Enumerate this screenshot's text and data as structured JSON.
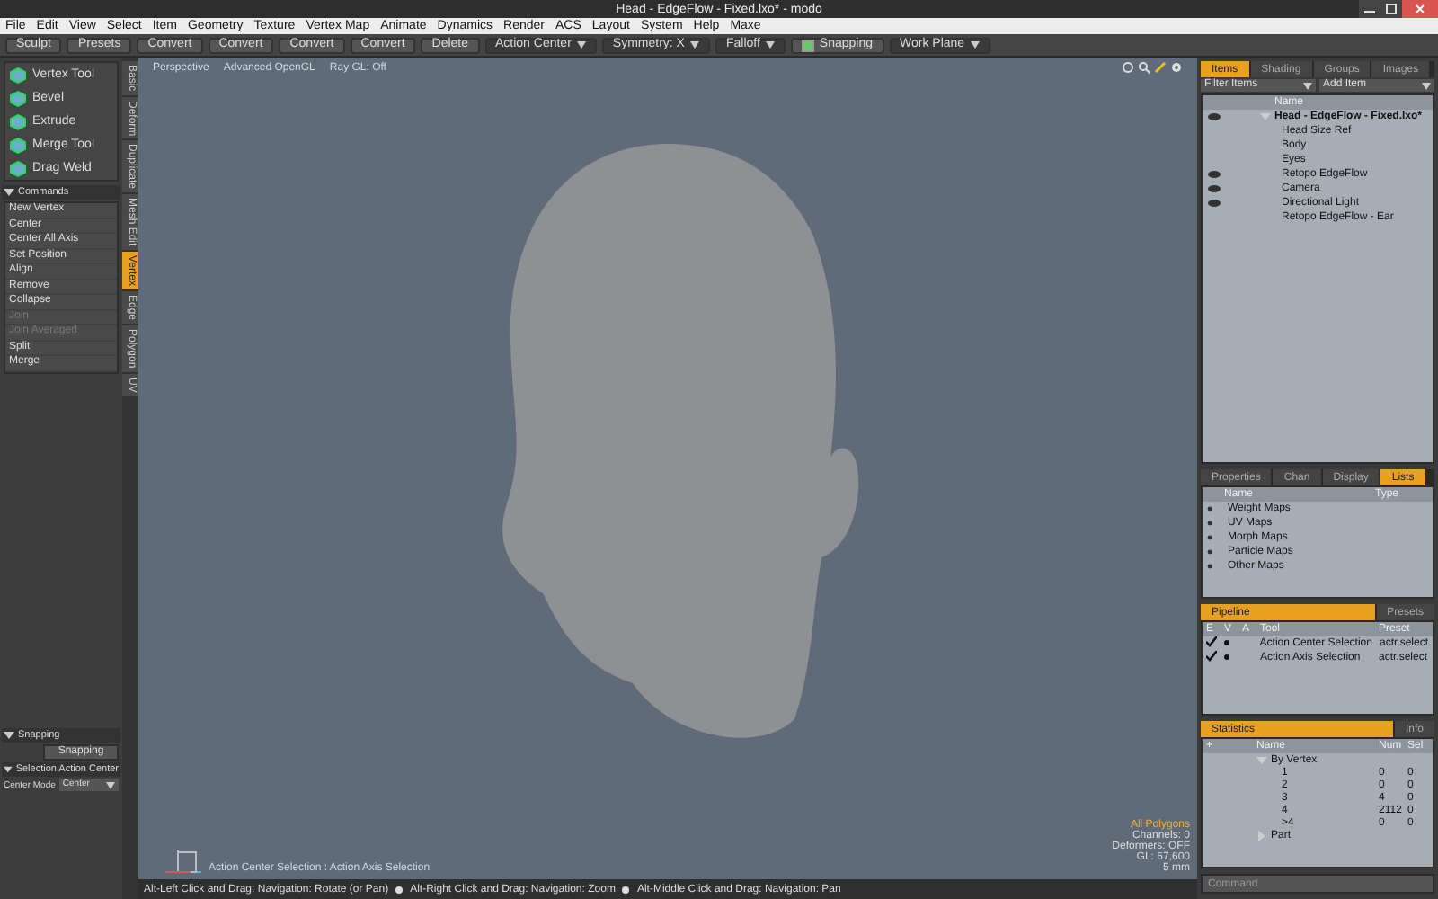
{
  "window": {
    "title": "Head - EdgeFlow - Fixed.lxo* - modo"
  },
  "menu": [
    "File",
    "Edit",
    "View",
    "Select",
    "Item",
    "Geometry",
    "Texture",
    "Vertex Map",
    "Animate",
    "Dynamics",
    "Render",
    "ACS",
    "Layout",
    "System",
    "Help",
    "Maxe"
  ],
  "toolbar": [
    {
      "kind": "button",
      "label": "Sculpt"
    },
    {
      "kind": "button",
      "label": "Presets"
    },
    {
      "kind": "button",
      "label": "Convert"
    },
    {
      "kind": "button",
      "label": "Convert"
    },
    {
      "kind": "button",
      "label": "Convert"
    },
    {
      "kind": "button",
      "label": "Convert"
    },
    {
      "kind": "button",
      "label": "Delete"
    },
    {
      "kind": "dropdown",
      "label": "Action Center"
    },
    {
      "kind": "dropdown",
      "label": "Symmetry: X"
    },
    {
      "kind": "dropdown",
      "label": "Falloff"
    },
    {
      "kind": "toggle",
      "label": "Snapping",
      "checked": true
    },
    {
      "kind": "dropdown",
      "label": "Work Plane"
    }
  ],
  "tools": [
    "Vertex Tool",
    "Bevel",
    "Extrude",
    "Merge Tool",
    "Drag Weld"
  ],
  "commands": {
    "title": "Commands",
    "expanded": true,
    "items": [
      {
        "label": "New Vertex",
        "disabled": false
      },
      {
        "label": "Center",
        "disabled": false
      },
      {
        "label": "Center All Axis",
        "disabled": false
      },
      {
        "label": "Set Position",
        "disabled": false
      },
      {
        "label": "Align",
        "disabled": false
      },
      {
        "label": "Remove",
        "disabled": false
      },
      {
        "label": "Collapse",
        "disabled": false
      },
      {
        "label": "Join",
        "disabled": true
      },
      {
        "label": "Join Averaged",
        "disabled": true
      },
      {
        "label": "Split",
        "disabled": false
      },
      {
        "label": "Merge",
        "disabled": false
      }
    ]
  },
  "snapping": {
    "title": "Snapping",
    "expanded": true,
    "button": "Snapping"
  },
  "action_center": {
    "title": "Selection Action Center",
    "expanded": true,
    "field_label": "Center Mode",
    "value": "Center"
  },
  "side_tabs": [
    {
      "label": "Basic",
      "selected": false
    },
    {
      "label": "Deform",
      "selected": false
    },
    {
      "label": "Duplicate",
      "selected": false
    },
    {
      "label": "Mesh Edit",
      "selected": false
    },
    {
      "label": "Vertex",
      "selected": true
    },
    {
      "label": "Edge",
      "selected": false
    },
    {
      "label": "Polygon",
      "selected": false
    },
    {
      "label": "UV",
      "selected": false
    }
  ],
  "viewport": {
    "tabs": [
      "Perspective",
      "Advanced OpenGL",
      "Ray GL: Off"
    ],
    "caption": "Action Center Selection : Action Axis Selection",
    "info": [
      {
        "kind": "highlight",
        "text": "All Polygons"
      },
      {
        "kind": "plain",
        "text": "Channels: 0"
      },
      {
        "kind": "plain",
        "text": "Deformers: OFF"
      },
      {
        "kind": "plain",
        "text": "GL: 67,600"
      },
      {
        "kind": "plain",
        "text": "5 mm"
      }
    ]
  },
  "status_bar": [
    "Alt-Left Click and Drag: Navigation: Rotate (or Pan)",
    "Alt-Right Click and Drag: Navigation: Zoom",
    "Alt-Middle Click and Drag: Navigation: Pan"
  ],
  "items_panel": {
    "tabs": [
      {
        "label": "Items",
        "selected": true
      },
      {
        "label": "Shading",
        "selected": false
      },
      {
        "label": "Groups",
        "selected": false
      },
      {
        "label": "Images",
        "selected": false
      }
    ],
    "filter": "Filter Items",
    "add": "Add Item",
    "column": "Name",
    "tree": [
      {
        "name": "Head - EdgeFlow - Fixed.lxo*",
        "visible": true,
        "expanded": true,
        "children": [
          {
            "name": "Head Size Ref",
            "visible": false
          },
          {
            "name": "Body",
            "visible": false
          },
          {
            "name": "Eyes",
            "visible": false
          },
          {
            "name": "Retopo EdgeFlow",
            "visible": true
          },
          {
            "name": "Camera",
            "visible": true
          },
          {
            "name": "Directional Light",
            "visible": true
          },
          {
            "name": "Retopo EdgeFlow - Ear",
            "visible": false
          }
        ]
      }
    ]
  },
  "lists_panel": {
    "tabs": [
      {
        "label": "Properties",
        "selected": false
      },
      {
        "label": "Chan",
        "selected": false
      },
      {
        "label": "Display",
        "selected": false
      },
      {
        "label": "Lists",
        "selected": true
      }
    ],
    "columns": [
      "Name",
      "Type"
    ],
    "rows": [
      "Weight Maps",
      "UV Maps",
      "Morph Maps",
      "Particle Maps",
      "Other Maps"
    ]
  },
  "pipeline_panel": {
    "tabs": [
      {
        "label": "Pipeline",
        "selected": true
      },
      {
        "label": "Presets",
        "selected": false
      }
    ],
    "columns": [
      "E",
      "V",
      "A",
      "Tool",
      "Preset"
    ],
    "rows": [
      {
        "enabled": true,
        "tool": "Action Center Selection",
        "preset": "actr.select"
      },
      {
        "enabled": true,
        "tool": "Action Axis Selection",
        "preset": "actr.select"
      }
    ]
  },
  "statistics_panel": {
    "tabs": [
      {
        "label": "Statistics",
        "selected": true
      },
      {
        "label": "Info",
        "selected": false
      }
    ],
    "columns": [
      "+",
      "Name",
      "Num",
      "Sel"
    ],
    "rows": [
      {
        "name": "By Vertex",
        "expanded": true,
        "children": [
          {
            "name": "1",
            "num": "0",
            "sel": "0"
          },
          {
            "name": "2",
            "num": "0",
            "sel": "0"
          },
          {
            "name": "3",
            "num": "4",
            "sel": "0"
          },
          {
            "name": "4",
            "num": "2112",
            "sel": "0"
          },
          {
            "name": ">4",
            "num": "0",
            "sel": "0"
          }
        ]
      },
      {
        "name": "Part",
        "expanded": false,
        "children": []
      }
    ]
  },
  "command_field": {
    "placeholder": "Command"
  }
}
